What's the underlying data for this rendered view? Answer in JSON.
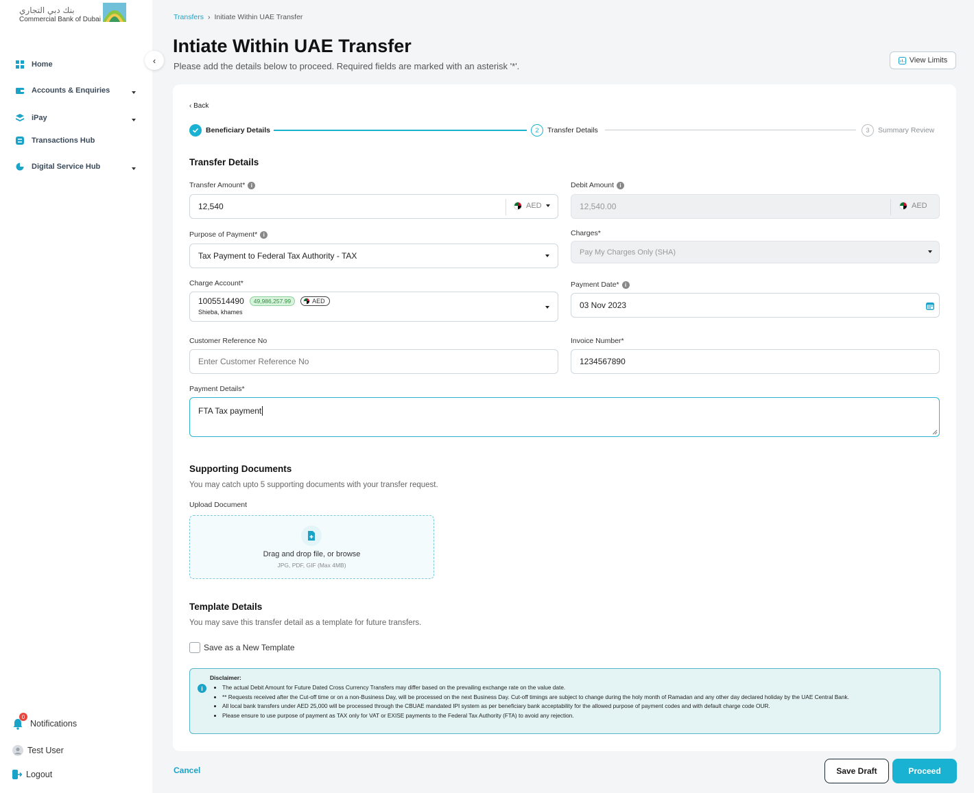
{
  "brand": {
    "name_ar": "بنك دبي التجاري",
    "name_en": "Commercial Bank of Dubai"
  },
  "sidebar": {
    "items": [
      {
        "label": "Home",
        "icon": "grid-icon"
      },
      {
        "label": "Accounts & Enquiries",
        "icon": "wallet-icon"
      },
      {
        "label": "iPay",
        "icon": "layers-icon"
      },
      {
        "label": "Transactions Hub",
        "icon": "exchange-icon"
      },
      {
        "label": "Digital Service Hub",
        "icon": "pie-icon"
      }
    ],
    "notifications_label": "Notifications",
    "notifications_count": "0",
    "user_label": "Test User",
    "logout_label": "Logout"
  },
  "header": {
    "breadcrumb_root": "Transfers",
    "breadcrumb_current": "Initiate Within UAE Transfer",
    "title": "Intiate Within UAE Transfer",
    "subtitle": "Please add the details below to proceed. Required fields are marked with an asterisk '*'.",
    "view_limits_label": "View Limits"
  },
  "stepper": {
    "back_label": "Back",
    "steps": [
      {
        "number": "1",
        "label": "Beneficiary Details",
        "state": "complete"
      },
      {
        "number": "2",
        "label": "Transfer Details",
        "state": "active"
      },
      {
        "number": "3",
        "label": "Summary Review",
        "state": "pending"
      }
    ]
  },
  "form": {
    "section_title": "Transfer Details",
    "transfer_amount": {
      "label": "Transfer Amount*",
      "value": "12,540",
      "currency": "AED"
    },
    "debit_amount": {
      "label": "Debit Amount",
      "value": "12,540.00",
      "currency": "AED"
    },
    "purpose": {
      "label": "Purpose of Payment*",
      "value": "Tax Payment to Federal Tax Authority - TAX"
    },
    "charges": {
      "label": "Charges*",
      "value": "Pay My Charges Only (SHA)"
    },
    "charge_account": {
      "label": "Charge Account*",
      "number": "1005514490",
      "balance": "49,986,257.99",
      "currency": "AED",
      "holder": "Shieba, khames"
    },
    "payment_date": {
      "label": "Payment Date*",
      "value": "03 Nov 2023"
    },
    "customer_ref": {
      "label": "Customer Reference No",
      "placeholder": "Enter Customer Reference No"
    },
    "invoice_number": {
      "label": "Invoice Number*",
      "value": "1234567890"
    },
    "payment_details": {
      "label": "Payment Details*",
      "value": "FTA Tax payment"
    }
  },
  "documents": {
    "title": "Supporting Documents",
    "subtitle": "You may catch upto 5 supporting documents with your transfer request.",
    "upload_label": "Upload Document",
    "drop_text": "Drag and drop file, or browse",
    "drop_hint": "JPG, PDF, GIF (Max 4MB)"
  },
  "template": {
    "title": "Template Details",
    "subtitle": "You may save this transfer detail as a template for future transfers.",
    "checkbox_label": "Save as a New Template"
  },
  "disclaimer": {
    "title": "Disclaimer:",
    "items": [
      "The actual Debit Amount for Future Dated Cross Currency Transfers may differ based on the prevailing exchange rate on the value date.",
      "** Requests received after the Cut-off time or on a non-Business Day, will be processed on the next Business Day. Cut-off timings are subject to change during the holy month of Ramadan and any other day declared holiday by the UAE Central Bank.",
      "All local bank transfers under AED 25,000 will be processed through the CBUAE mandated IPI system as per beneficiary bank acceptability for the allowed purpose of payment codes and with default charge code OUR.",
      "Please ensure to use purpose of payment as TAX only for VAT or EXISE payments to the Federal Tax Authority (FTA) to avoid any rejection."
    ]
  },
  "footer": {
    "cancel_label": "Cancel",
    "save_draft_label": "Save Draft",
    "proceed_label": "Proceed"
  },
  "colors": {
    "accent": "#1ab2d3",
    "link": "#1aa3c8",
    "positive": "#2e8b3e"
  }
}
